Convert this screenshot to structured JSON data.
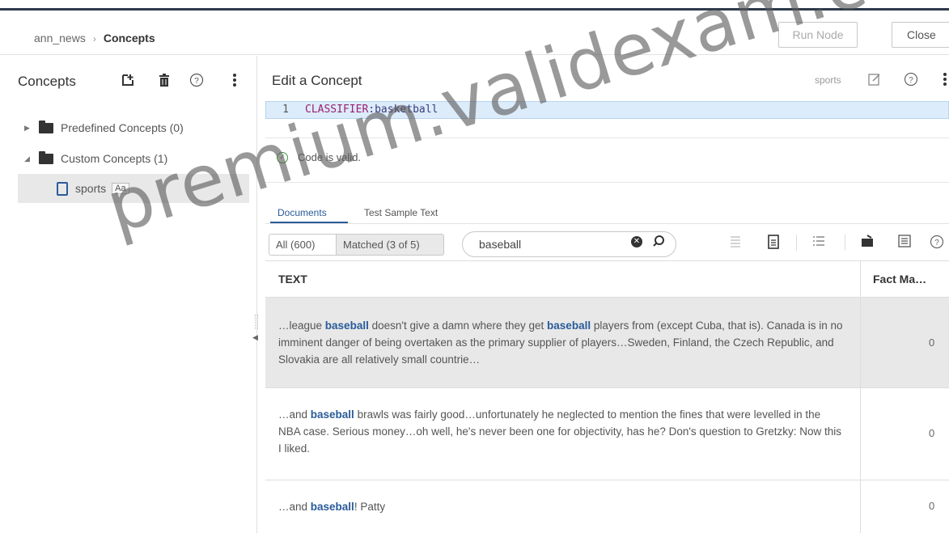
{
  "header": {
    "breadcrumb_parent": "ann_news",
    "breadcrumb_separator": "›",
    "breadcrumb_current": "Concepts",
    "run_node_label": "Run Node",
    "close_label": "Close"
  },
  "left_panel": {
    "title": "Concepts",
    "icons": [
      "add-concept-icon",
      "trash-icon",
      "help-icon",
      "more-vertical-icon"
    ],
    "tree": [
      {
        "label": "Predefined Concepts (0)",
        "expanded": false
      },
      {
        "label": "Custom Concepts (1)",
        "expanded": true
      }
    ],
    "selected_item": {
      "label": "sports",
      "badge": "Aa"
    }
  },
  "editor": {
    "title": "Edit a Concept",
    "concept_tag": "sports",
    "code_line_number": "1",
    "code_keyword": "CLASSIFIER",
    "code_value": ":basketball",
    "validation_message": "Code is valid."
  },
  "tabs": {
    "documents": "Documents",
    "test_sample": "Test Sample Text"
  },
  "toolbar": {
    "all_label": "All (600)",
    "matched_label": "Matched (3 of 5)",
    "search_value": "baseball"
  },
  "table": {
    "col_text": "TEXT",
    "col_fact": "Fact Ma…",
    "rows": [
      {
        "parts": [
          "…league ",
          "baseball",
          " doesn't give a damn where they get ",
          "baseball",
          " players from (except Cuba, that is). Canada is in no imminent danger of being overtaken as the primary supplier of players…Sweden, Finland, the Czech Republic, and Slovakia are all relatively small countrie…"
        ],
        "count": "0"
      },
      {
        "parts": [
          "…and ",
          "baseball",
          " brawls was fairly good…unfortunately he neglected to mention the fines that were levelled in the NBA case. Serious money…oh well, he's never been one for objectivity, has he? Don's question to Gretzky: Now this I liked."
        ],
        "count": "0"
      },
      {
        "parts": [
          "…and ",
          "baseball",
          "! Patty"
        ],
        "count": "0"
      }
    ]
  },
  "watermark": "premium.validexam.com",
  "colors": {
    "accent": "#2a5b9a",
    "valid_green": "#3d9a41",
    "selected_row": "#e8e8e8"
  }
}
